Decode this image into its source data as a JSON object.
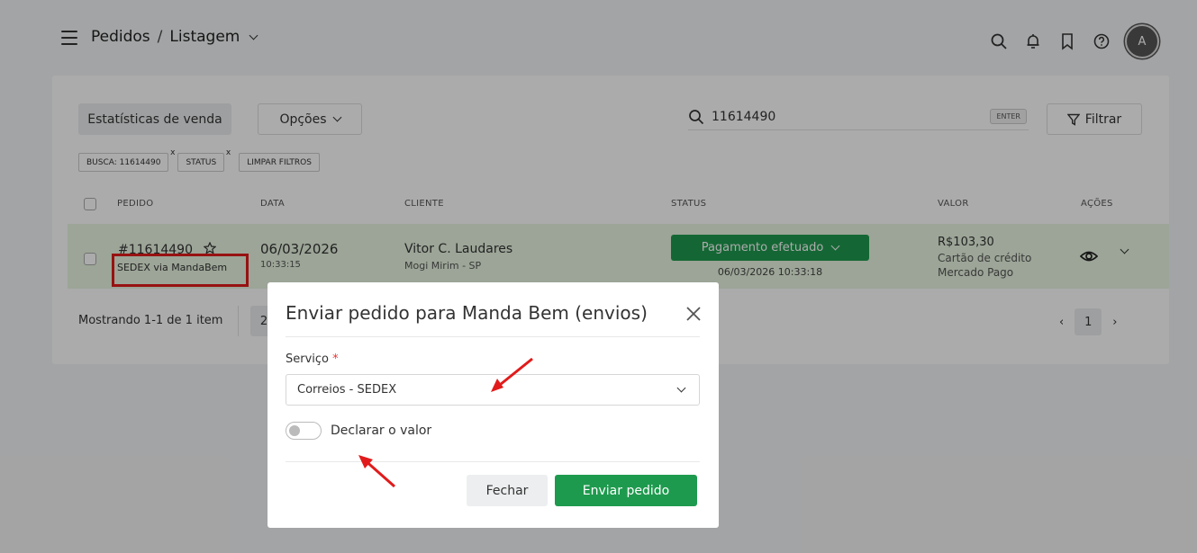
{
  "header": {
    "breadcrumb_section": "Pedidos",
    "breadcrumb_separator": "/",
    "breadcrumb_page": "Listagem",
    "avatar_initial": "A"
  },
  "toolbar": {
    "stats_label": "Estatísticas de venda",
    "options_label": "Opções",
    "search_value": "11614490",
    "search_hint": "ENTER",
    "filter_label": "Filtrar"
  },
  "chips": {
    "search_chip": "BUSCA: 11614490",
    "status_chip": "STATUS",
    "remove_mark": "x",
    "clear_label": "LIMPAR FILTROS"
  },
  "table": {
    "headers": {
      "order": "PEDIDO",
      "date": "DATA",
      "client": "CLIENTE",
      "status": "STATUS",
      "value": "VALOR",
      "actions": "AÇÕES"
    },
    "rows": [
      {
        "order_id": "#11614490",
        "shipping": "SEDEX via MandaBem",
        "date": "06/03/2026",
        "time": "10:33:15",
        "client_name": "Vitor C. Laudares",
        "client_city": "Mogi Mirim - SP",
        "status": "Pagamento efetuado",
        "status_date": "06/03/2026 10:33:18",
        "value": "R$103,30",
        "payment_method": "Cartão de crédito",
        "payment_gateway": "Mercado Pago"
      }
    ]
  },
  "footer": {
    "showing": "Mostrando 1-1 de 1 item",
    "per_page": "2",
    "prev": "‹",
    "current_page": "1",
    "next": "›"
  },
  "modal": {
    "title": "Enviar pedido para Manda Bem (envios)",
    "service_label": "Serviço",
    "required_mark": "*",
    "service_value": "Correios - SEDEX",
    "declare_label": "Declarar o valor",
    "close_label": "Fechar",
    "send_label": "Enviar pedido"
  },
  "colors": {
    "primary_green": "#1e9a4e",
    "row_highlight": "#e9f6e1",
    "annotation_red": "#e11b1b"
  }
}
